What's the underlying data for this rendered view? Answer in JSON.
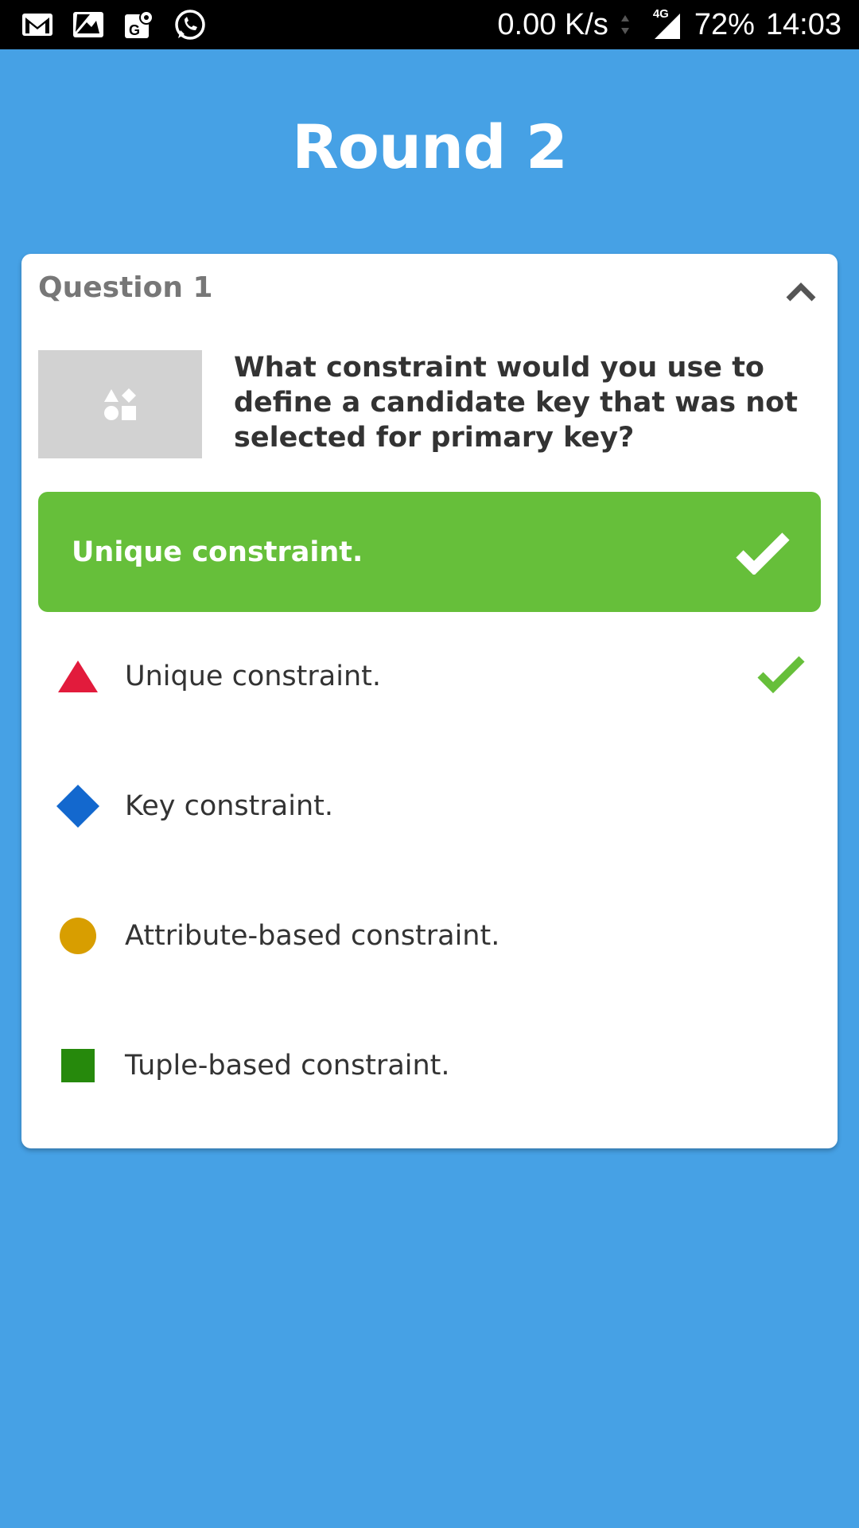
{
  "status_bar": {
    "net_speed": "0.00 K/s",
    "network_type": "4G",
    "battery": "72%",
    "time": "14:03",
    "icons": [
      "gmail-icon",
      "photo-icon",
      "maps-icon",
      "whatsapp-icon"
    ]
  },
  "round": {
    "title": "Round 2"
  },
  "question": {
    "label": "Question 1",
    "text": "What constraint would you use to define a candidate key that was not selected for primary key?",
    "image_placeholder_icon": "shapes-icon"
  },
  "correct_answer": {
    "text": "Unique constraint."
  },
  "options": [
    {
      "label": "Unique constraint.",
      "shape": "triangle",
      "color": "#e21b3c",
      "correct": true
    },
    {
      "label": "Key constraint.",
      "shape": "diamond",
      "color": "#1368ce",
      "correct": false
    },
    {
      "label": "Attribute-based constraint.",
      "shape": "circle",
      "color": "#d89e00",
      "correct": false
    },
    {
      "label": "Tuple-based constraint.",
      "shape": "square",
      "color": "#26890c",
      "correct": false
    }
  ],
  "colors": {
    "background": "#46a1e5",
    "correct_green": "#66bf3a",
    "card": "#ffffff"
  }
}
